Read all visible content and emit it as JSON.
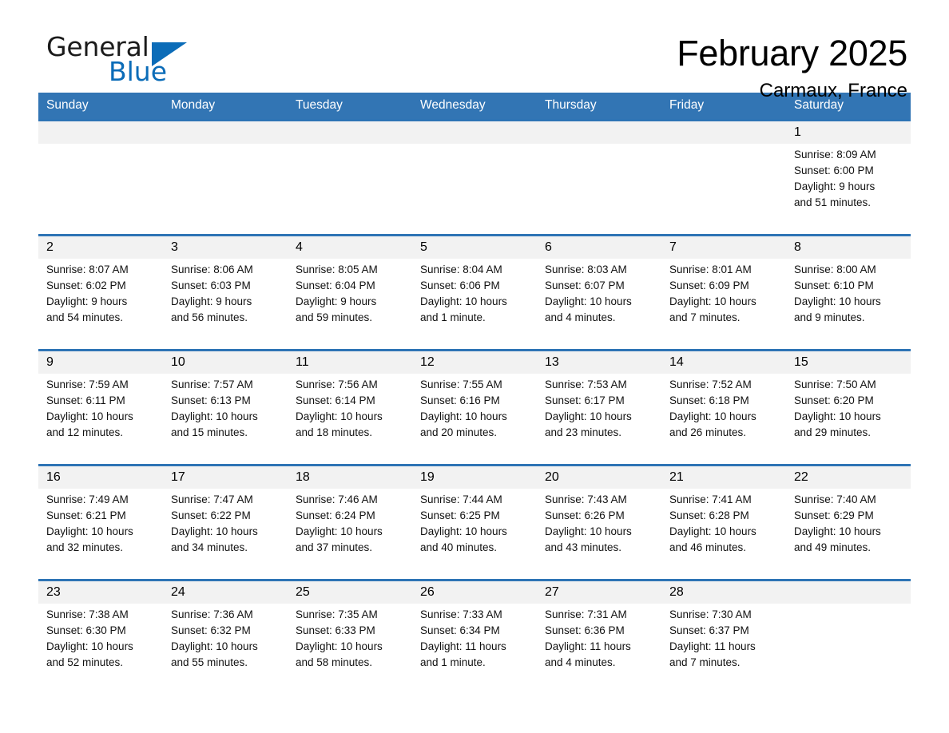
{
  "brand": {
    "name_part1": "General",
    "name_part2": "Blue",
    "triangle_color": "#0b6cb8"
  },
  "header": {
    "title": "February 2025",
    "location": "Carmaux, France"
  },
  "theme": {
    "header_blue": "#3275b4",
    "rule_blue": "#2e74b5",
    "daynum_band": "#f2f2f2",
    "page_background": "#ffffff"
  },
  "weekday_headers": [
    "Sunday",
    "Monday",
    "Tuesday",
    "Wednesday",
    "Thursday",
    "Friday",
    "Saturday"
  ],
  "weeks": [
    [
      {
        "day": "",
        "lines": []
      },
      {
        "day": "",
        "lines": []
      },
      {
        "day": "",
        "lines": []
      },
      {
        "day": "",
        "lines": []
      },
      {
        "day": "",
        "lines": []
      },
      {
        "day": "",
        "lines": []
      },
      {
        "day": "1",
        "lines": [
          "Sunrise: 8:09 AM",
          "Sunset: 6:00 PM",
          "Daylight: 9 hours",
          "and 51 minutes."
        ]
      }
    ],
    [
      {
        "day": "2",
        "lines": [
          "Sunrise: 8:07 AM",
          "Sunset: 6:02 PM",
          "Daylight: 9 hours",
          "and 54 minutes."
        ]
      },
      {
        "day": "3",
        "lines": [
          "Sunrise: 8:06 AM",
          "Sunset: 6:03 PM",
          "Daylight: 9 hours",
          "and 56 minutes."
        ]
      },
      {
        "day": "4",
        "lines": [
          "Sunrise: 8:05 AM",
          "Sunset: 6:04 PM",
          "Daylight: 9 hours",
          "and 59 minutes."
        ]
      },
      {
        "day": "5",
        "lines": [
          "Sunrise: 8:04 AM",
          "Sunset: 6:06 PM",
          "Daylight: 10 hours",
          "and 1 minute."
        ]
      },
      {
        "day": "6",
        "lines": [
          "Sunrise: 8:03 AM",
          "Sunset: 6:07 PM",
          "Daylight: 10 hours",
          "and 4 minutes."
        ]
      },
      {
        "day": "7",
        "lines": [
          "Sunrise: 8:01 AM",
          "Sunset: 6:09 PM",
          "Daylight: 10 hours",
          "and 7 minutes."
        ]
      },
      {
        "day": "8",
        "lines": [
          "Sunrise: 8:00 AM",
          "Sunset: 6:10 PM",
          "Daylight: 10 hours",
          "and 9 minutes."
        ]
      }
    ],
    [
      {
        "day": "9",
        "lines": [
          "Sunrise: 7:59 AM",
          "Sunset: 6:11 PM",
          "Daylight: 10 hours",
          "and 12 minutes."
        ]
      },
      {
        "day": "10",
        "lines": [
          "Sunrise: 7:57 AM",
          "Sunset: 6:13 PM",
          "Daylight: 10 hours",
          "and 15 minutes."
        ]
      },
      {
        "day": "11",
        "lines": [
          "Sunrise: 7:56 AM",
          "Sunset: 6:14 PM",
          "Daylight: 10 hours",
          "and 18 minutes."
        ]
      },
      {
        "day": "12",
        "lines": [
          "Sunrise: 7:55 AM",
          "Sunset: 6:16 PM",
          "Daylight: 10 hours",
          "and 20 minutes."
        ]
      },
      {
        "day": "13",
        "lines": [
          "Sunrise: 7:53 AM",
          "Sunset: 6:17 PM",
          "Daylight: 10 hours",
          "and 23 minutes."
        ]
      },
      {
        "day": "14",
        "lines": [
          "Sunrise: 7:52 AM",
          "Sunset: 6:18 PM",
          "Daylight: 10 hours",
          "and 26 minutes."
        ]
      },
      {
        "day": "15",
        "lines": [
          "Sunrise: 7:50 AM",
          "Sunset: 6:20 PM",
          "Daylight: 10 hours",
          "and 29 minutes."
        ]
      }
    ],
    [
      {
        "day": "16",
        "lines": [
          "Sunrise: 7:49 AM",
          "Sunset: 6:21 PM",
          "Daylight: 10 hours",
          "and 32 minutes."
        ]
      },
      {
        "day": "17",
        "lines": [
          "Sunrise: 7:47 AM",
          "Sunset: 6:22 PM",
          "Daylight: 10 hours",
          "and 34 minutes."
        ]
      },
      {
        "day": "18",
        "lines": [
          "Sunrise: 7:46 AM",
          "Sunset: 6:24 PM",
          "Daylight: 10 hours",
          "and 37 minutes."
        ]
      },
      {
        "day": "19",
        "lines": [
          "Sunrise: 7:44 AM",
          "Sunset: 6:25 PM",
          "Daylight: 10 hours",
          "and 40 minutes."
        ]
      },
      {
        "day": "20",
        "lines": [
          "Sunrise: 7:43 AM",
          "Sunset: 6:26 PM",
          "Daylight: 10 hours",
          "and 43 minutes."
        ]
      },
      {
        "day": "21",
        "lines": [
          "Sunrise: 7:41 AM",
          "Sunset: 6:28 PM",
          "Daylight: 10 hours",
          "and 46 minutes."
        ]
      },
      {
        "day": "22",
        "lines": [
          "Sunrise: 7:40 AM",
          "Sunset: 6:29 PM",
          "Daylight: 10 hours",
          "and 49 minutes."
        ]
      }
    ],
    [
      {
        "day": "23",
        "lines": [
          "Sunrise: 7:38 AM",
          "Sunset: 6:30 PM",
          "Daylight: 10 hours",
          "and 52 minutes."
        ]
      },
      {
        "day": "24",
        "lines": [
          "Sunrise: 7:36 AM",
          "Sunset: 6:32 PM",
          "Daylight: 10 hours",
          "and 55 minutes."
        ]
      },
      {
        "day": "25",
        "lines": [
          "Sunrise: 7:35 AM",
          "Sunset: 6:33 PM",
          "Daylight: 10 hours",
          "and 58 minutes."
        ]
      },
      {
        "day": "26",
        "lines": [
          "Sunrise: 7:33 AM",
          "Sunset: 6:34 PM",
          "Daylight: 11 hours",
          "and 1 minute."
        ]
      },
      {
        "day": "27",
        "lines": [
          "Sunrise: 7:31 AM",
          "Sunset: 6:36 PM",
          "Daylight: 11 hours",
          "and 4 minutes."
        ]
      },
      {
        "day": "28",
        "lines": [
          "Sunrise: 7:30 AM",
          "Sunset: 6:37 PM",
          "Daylight: 11 hours",
          "and 7 minutes."
        ]
      },
      {
        "day": "",
        "lines": []
      }
    ]
  ]
}
